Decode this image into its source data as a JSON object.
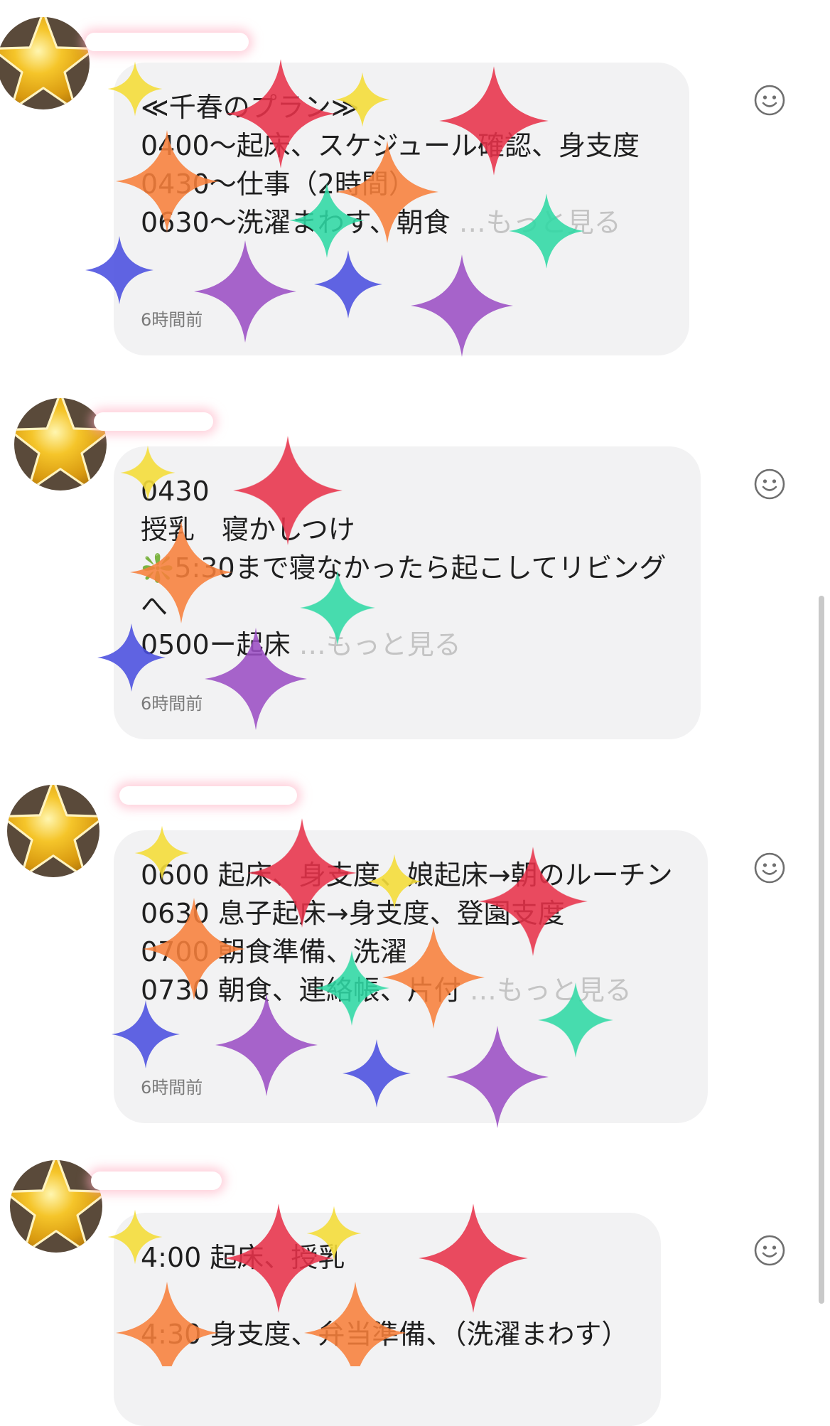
{
  "comments": [
    {
      "text": "≪千春のプラン≫\n0400〜起床、スケジュール確認、身支度\n0430〜仕事（2時間）\n0630〜洗濯まわす、朝食",
      "more": " …もっと見る",
      "time": "6時間前"
    },
    {
      "text": "0430\n授乳　寝かしつけ\n❇️5:30まで寝なかったら起こしてリビングへ\n0500ー起床",
      "more": " …もっと見る",
      "time": "6時間前"
    },
    {
      "text": "0600 起床、身支度、娘起床→朝のルーチン\n0630 息子起床→身支度、登園支度\n0700 朝食準備、洗濯\n0730 朝食、連絡帳、片付",
      "more": " …もっと見る",
      "time": "6時間前"
    },
    {
      "text": "4:00 起床、授乳\n\n4:30 身支度、弁当準備、（洗濯まわす）",
      "more": "",
      "time": ""
    }
  ],
  "icons": {
    "reaction": "smiley-face-icon",
    "avatar_sticker": "gold-star-icon",
    "decoration": "sparkle-icon"
  },
  "colors": {
    "bubble": "#f2f2f3",
    "text": "#1f1f1f",
    "more": "#c4c4c4",
    "time": "#7a7a7a",
    "icon": "#6f6f6f",
    "sparkle_red": "#e8334a",
    "sparkle_orange": "#f7803c",
    "sparkle_teal": "#2fd9a4",
    "sparkle_purple": "#9b4fc4",
    "sparkle_blue": "#4a4fe0",
    "sparkle_yellow": "#f4dd3a"
  }
}
